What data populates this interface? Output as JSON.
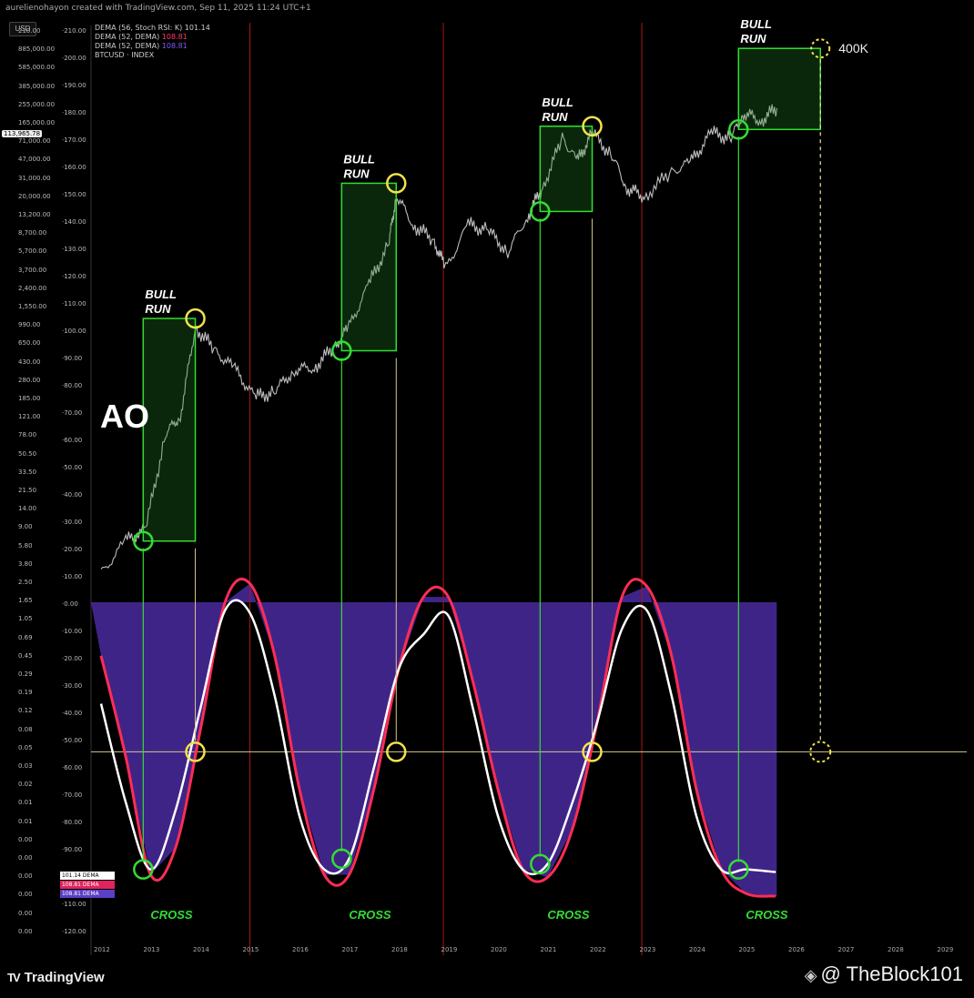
{
  "header": {
    "creator_line": "aurelienohayon created with TradingView.com, Sep 11, 2025 11:24 UTC+1",
    "currency": "USD",
    "current_price": "113,965.78"
  },
  "legend": {
    "line1": "DEMA (56, Stoch RSI: K)  101.14",
    "line2_label": "DEMA (52, DEMA)",
    "line2_value": "108.81",
    "line3_label": "DEMA (52, DEMA)",
    "line3_value": "108.81",
    "line4": "BTCUSD · INDEX"
  },
  "mini_legend": {
    "white": "101.14  DEMA",
    "red": "108.81  DEMA",
    "purple": "108.81  DEMA"
  },
  "labels": {
    "ao": "AO",
    "bull_run_line1": "BULL",
    "bull_run_line2": "RUN",
    "cross": "CROSS",
    "target": "400K"
  },
  "footer": {
    "brand": "TradingView",
    "credit": "@ TheBlock101"
  },
  "colors": {
    "red_line": "#ff2d55",
    "white_line": "#ffffff",
    "purple_fill": "#4a2aa0",
    "green_box": "#33dd33",
    "yellow_circle": "#f2e34a",
    "vertical_red": "#a31818"
  },
  "chart_data": {
    "type": "line",
    "x_axis": {
      "tick_labels": [
        "2012",
        "2013",
        "2014",
        "2015",
        "2016",
        "2017",
        "2018",
        "2019",
        "2020",
        "2021",
        "2022",
        "2023",
        "2024",
        "2025",
        "2026",
        "2027",
        "2028",
        "2029"
      ]
    },
    "price_axis_labels": [
      "210.00",
      "885,000.00",
      "585,000.00",
      "385,000.00",
      "255,000.00",
      "165,000.00",
      "71,000.00",
      "47,000.00",
      "31,000.00",
      "20,000.00",
      "13,200.00",
      "8,700.00",
      "5,700.00",
      "3,700.00",
      "2,400.00",
      "1,550.00",
      "990.00",
      "650.00",
      "430.00",
      "280.00",
      "185.00",
      "121.00",
      "78.00",
      "50.50",
      "33.50",
      "21.50",
      "14.00",
      "9.00",
      "5.80",
      "3.80",
      "2.50",
      "1.65",
      "1.05",
      "0.69",
      "0.45",
      "0.29",
      "0.19",
      "0.12",
      "0.08",
      "0.05",
      "0.03",
      "0.02",
      "0.01",
      "0.01",
      "0.00",
      "0.00",
      "0.00",
      "0.00",
      "0.00",
      "0.00"
    ],
    "oscillator_axis_labels": [
      "210.00",
      "200.00",
      "190.00",
      "180.00",
      "170.00",
      "160.00",
      "150.00",
      "140.00",
      "130.00",
      "120.00",
      "110.00",
      "100.00",
      "90.00",
      "80.00",
      "70.00",
      "60.00",
      "50.00",
      "40.00",
      "30.00",
      "20.00",
      "10.00",
      "0.00",
      "10.00",
      "20.00",
      "30.00",
      "40.00",
      "50.00",
      "60.00",
      "70.00",
      "80.00",
      "90.00",
      "100.00",
      "110.00",
      "120.00"
    ],
    "vertical_markers_years": [
      2015,
      2018.9,
      2022.9
    ],
    "btc_price": {
      "name": "BTCUSD",
      "x": [
        2012.0,
        2012.5,
        2012.9,
        2013.3,
        2013.6,
        2013.9,
        2014.3,
        2014.7,
        2015.1,
        2015.5,
        2015.9,
        2016.3,
        2016.7,
        2017.0,
        2017.4,
        2017.8,
        2017.95,
        2018.3,
        2018.7,
        2018.95,
        2019.4,
        2019.8,
        2020.2,
        2020.6,
        2020.9,
        2021.3,
        2021.6,
        2021.9,
        2022.3,
        2022.6,
        2022.95,
        2023.5,
        2023.9,
        2024.3,
        2024.7,
        2024.95,
        2025.3,
        2025.65
      ],
      "y": [
        5,
        10,
        13,
        100,
        150,
        1000,
        600,
        400,
        220,
        250,
        400,
        420,
        650,
        1000,
        2500,
        6000,
        17000,
        9000,
        6500,
        3500,
        9000,
        8000,
        5000,
        11000,
        20000,
        58000,
        35000,
        65000,
        40000,
        20000,
        16500,
        28000,
        35000,
        65000,
        58000,
        100000,
        85000,
        113000
      ]
    },
    "oscillator_red": {
      "name": "DEMA (52, DEMA)",
      "x": [
        2012.0,
        2012.5,
        2013.0,
        2013.5,
        2014.0,
        2014.5,
        2015.0,
        2015.5,
        2016.0,
        2016.5,
        2017.0,
        2017.5,
        2018.0,
        2018.5,
        2019.0,
        2019.5,
        2020.0,
        2020.5,
        2021.0,
        2021.5,
        2022.0,
        2022.5,
        2023.0,
        2023.5,
        2024.0,
        2024.5,
        2025.0,
        2025.6
      ],
      "y": [
        20,
        58,
        102,
        92,
        48,
        0,
        -7,
        20,
        70,
        102,
        102,
        70,
        25,
        -2,
        -2,
        30,
        70,
        100,
        103,
        85,
        45,
        -2,
        -6,
        20,
        70,
        100,
        109,
        110
      ]
    },
    "oscillator_white": {
      "name": "DEMA (56, Stoch RSI: K)",
      "x": [
        2012.0,
        2012.5,
        2013.0,
        2013.5,
        2014.0,
        2014.5,
        2015.0,
        2015.5,
        2016.0,
        2016.5,
        2017.0,
        2017.5,
        2018.0,
        2018.5,
        2019.0,
        2019.5,
        2020.0,
        2020.5,
        2021.0,
        2021.5,
        2022.0,
        2022.5,
        2023.0,
        2023.5,
        2024.0,
        2024.5,
        2025.0,
        2025.6
      ],
      "y": [
        38,
        75,
        100,
        78,
        40,
        3,
        4,
        35,
        80,
        100,
        96,
        62,
        25,
        12,
        5,
        40,
        80,
        100,
        98,
        75,
        45,
        10,
        3,
        35,
        80,
        100,
        100,
        101
      ]
    },
    "signal_level": 56,
    "bull_runs": [
      {
        "start": 2012.85,
        "end": 2013.9,
        "low": 10,
        "high": 1200
      },
      {
        "start": 2016.85,
        "end": 2017.95,
        "low": 600,
        "high": 22000
      },
      {
        "start": 2020.85,
        "end": 2021.9,
        "low": 12000,
        "high": 75000
      },
      {
        "start": 2024.85,
        "end": 2026.5,
        "low": 70000,
        "high": 400000
      }
    ],
    "crosses": [
      2012.85,
      2016.85,
      2020.85,
      2024.85
    ],
    "tops": [
      2013.9,
      2017.95,
      2021.9
    ],
    "target": {
      "x": 2026.5,
      "price": 400000
    }
  }
}
